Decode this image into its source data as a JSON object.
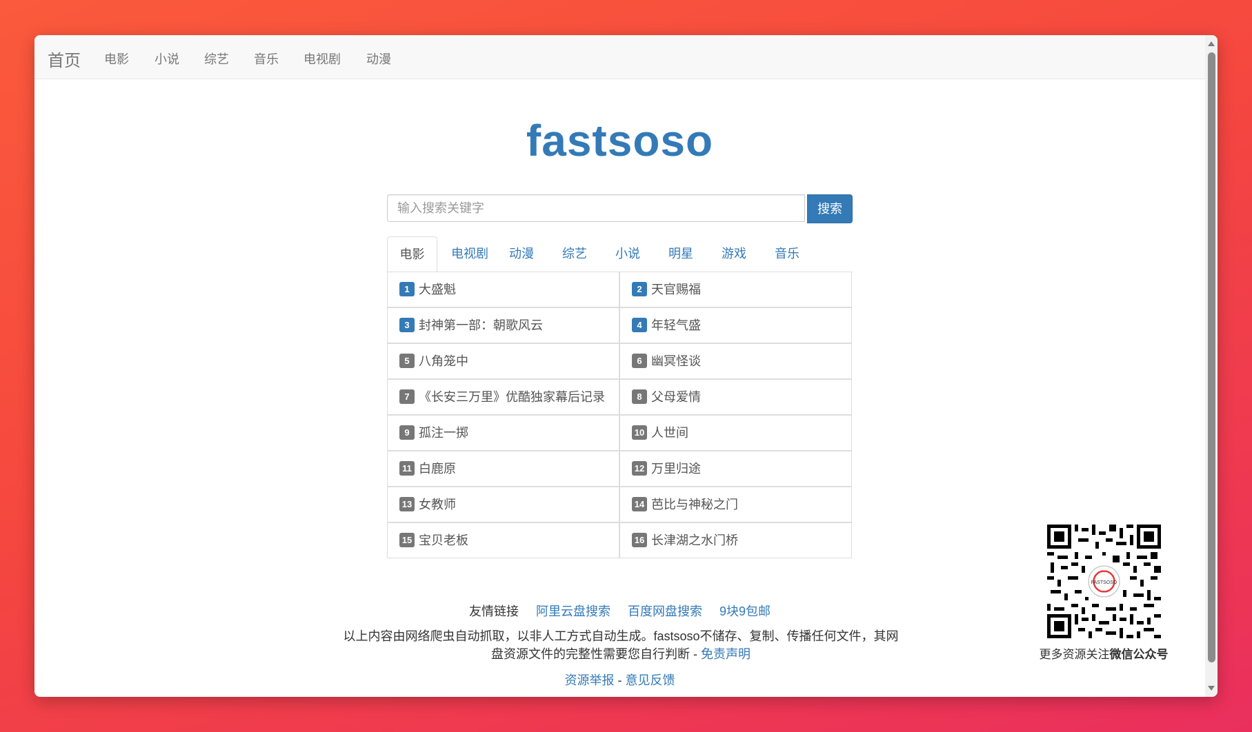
{
  "navbar": {
    "brand": "首页",
    "links": [
      "电影",
      "小说",
      "综艺",
      "音乐",
      "电视剧",
      "动漫"
    ]
  },
  "logo": "fastsoso",
  "search": {
    "placeholder": "输入搜索关键字",
    "button": "搜索"
  },
  "tabs": [
    "电影",
    "电视剧",
    "动漫",
    "综艺",
    "小说",
    "明星",
    "游戏",
    "音乐"
  ],
  "active_tab": "电影",
  "ranking": [
    {
      "rank": "1",
      "title": "大盛魁"
    },
    {
      "rank": "2",
      "title": "天官赐福"
    },
    {
      "rank": "3",
      "title": "封神第一部：朝歌风云"
    },
    {
      "rank": "4",
      "title": "年轻气盛"
    },
    {
      "rank": "5",
      "title": "八角笼中"
    },
    {
      "rank": "6",
      "title": "幽冥怪谈"
    },
    {
      "rank": "7",
      "title": "《长安三万里》优酷独家幕后记录"
    },
    {
      "rank": "8",
      "title": "父母爱情"
    },
    {
      "rank": "9",
      "title": "孤注一掷"
    },
    {
      "rank": "10",
      "title": "人世间"
    },
    {
      "rank": "11",
      "title": "白鹿原"
    },
    {
      "rank": "12",
      "title": "万里归途"
    },
    {
      "rank": "13",
      "title": "女教师"
    },
    {
      "rank": "14",
      "title": "芭比与神秘之门"
    },
    {
      "rank": "15",
      "title": "宝贝老板"
    },
    {
      "rank": "16",
      "title": "长津湖之水门桥"
    }
  ],
  "footer": {
    "friend_links_label": "友情链接",
    "friend_links": [
      "阿里云盘搜索",
      "百度网盘搜索",
      "9块9包邮"
    ],
    "disclaimer": "以上内容由网络爬虫自动抓取，以非人工方式自动生成。fastsoso不储存、复制、传播任何文件，其网盘资源文件的完整性需要您自行判断 - ",
    "disclaimer_link": "免责声明",
    "report_link": "资源举报",
    "separator": " - ",
    "feedback_link": "意见反馈"
  },
  "qr": {
    "caption_prefix": "更多资源关注",
    "caption_bold": "微信公众号",
    "center_label": "FASTSOSO"
  },
  "colors": {
    "link": "#337ab7",
    "badge_top": "#337ab7",
    "badge_rest": "#777777"
  }
}
